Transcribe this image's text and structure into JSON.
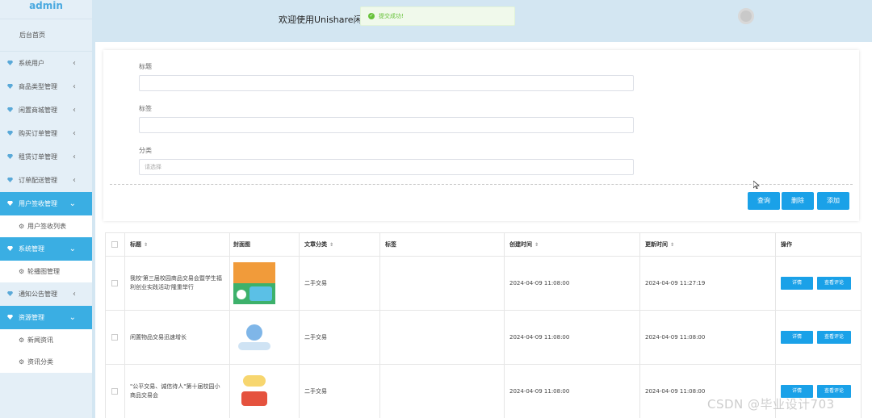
{
  "sidebar": {
    "brand": "admin",
    "home": "后台首页",
    "items": [
      {
        "label": "系统用户"
      },
      {
        "label": "商品类型管理"
      },
      {
        "label": "闲置商城管理"
      },
      {
        "label": "购买订单管理"
      },
      {
        "label": "租赁订单管理"
      },
      {
        "label": "订单配送管理"
      },
      {
        "label": "用户签收管理",
        "sub": "用户签收列表"
      },
      {
        "label": "系统管理",
        "sub": "轮播图管理"
      },
      {
        "label": "通知公告管理"
      },
      {
        "label": "资源管理",
        "subs": [
          "新闻资讯",
          "资讯分类"
        ]
      }
    ]
  },
  "header": {
    "welcome": "欢迎使用Unishare闲",
    "toast": "提交成功!"
  },
  "search": {
    "title_label": "标题",
    "tags_label": "标签",
    "category_label": "分类",
    "category_placeholder": "请选择",
    "query_button": "查询",
    "delete_button": "删除",
    "add_button": "添加"
  },
  "table": {
    "headers": [
      "标题",
      "封面图",
      "文章分类",
      "标签",
      "创建时间",
      "更新时间",
      "操作"
    ],
    "rows": [
      {
        "title": "我校'第三届校园商品交易会暨学生福利创业实践活动'隆重举行",
        "category": "二手交易",
        "tags": "",
        "created": "2024-04-09 11:08:00",
        "updated": "2024-04-09 11:27:19",
        "btn_detail": "详情",
        "btn_comment": "查看评论"
      },
      {
        "title": "闲置物品交易迅速增长",
        "category": "二手交易",
        "tags": "",
        "created": "2024-04-09 11:08:00",
        "updated": "2024-04-09 11:08:00",
        "btn_detail": "详情",
        "btn_comment": "查看评论"
      },
      {
        "title": "\"公平交易、诚信待人\"第十届校园小商品交易会",
        "category": "二手交易",
        "tags": "",
        "created": "2024-04-09 11:08:00",
        "updated": "2024-04-09 11:08:00",
        "btn_detail": "详情",
        "btn_comment": "查看评论"
      }
    ]
  },
  "watermark": "CSDN @毕业设计703",
  "colors": {
    "primary": "#1aa1e8",
    "menu_active": "#3aaee3",
    "brand": "#4aa9e0"
  }
}
